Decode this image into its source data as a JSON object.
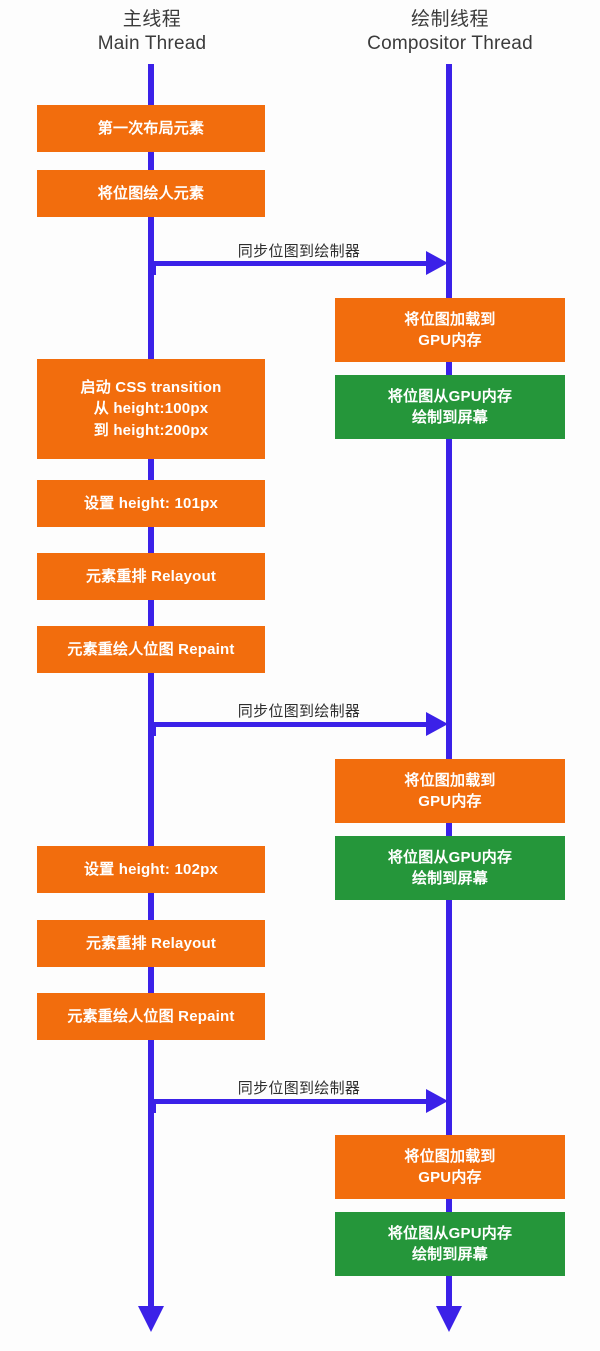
{
  "diagram": {
    "title": "CSS transition main thread vs compositor thread sequence",
    "colors": {
      "orange": "#f26d0d",
      "green": "#25963a",
      "lifeline_blue": "#3b21e8",
      "background": "#fdfdfd",
      "header_text": "#3b3b3b"
    }
  },
  "threads": [
    {
      "zh": "主线程",
      "en": "Main Thread"
    },
    {
      "zh": "绘制线程",
      "en": "Compositor Thread"
    }
  ],
  "main_thread_steps": [
    {
      "text": "第一次布局元素",
      "color": "orange"
    },
    {
      "text": "将位图绘人元素",
      "color": "orange"
    },
    {
      "text": "启动 CSS transition\n从 height:100px\n到 height:200px",
      "color": "orange"
    },
    {
      "text": "设置 height: 101px",
      "color": "orange"
    },
    {
      "text": "元素重排 Relayout",
      "color": "orange"
    },
    {
      "text": "元素重绘人位图 Repaint",
      "color": "orange"
    },
    {
      "text": "设置 height: 102px",
      "color": "orange"
    },
    {
      "text": "元素重排 Relayout",
      "color": "orange"
    },
    {
      "text": "元素重绘人位图 Repaint",
      "color": "orange"
    }
  ],
  "compositor_thread_steps": [
    {
      "text": "将位图加载到\nGPU内存",
      "color": "orange"
    },
    {
      "text": "将位图从GPU内存\n绘制到屏幕",
      "color": "green"
    },
    {
      "text": "将位图加载到\nGPU内存",
      "color": "orange"
    },
    {
      "text": "将位图从GPU内存\n绘制到屏幕",
      "color": "green"
    },
    {
      "text": "将位图加载到\nGPU内存",
      "color": "orange"
    },
    {
      "text": "将位图从GPU内存\n绘制到屏幕",
      "color": "green"
    }
  ],
  "sync_messages": [
    {
      "label": "同步位图到绘制器"
    },
    {
      "label": "同步位图到绘制器"
    },
    {
      "label": "同步位图到绘制器"
    }
  ]
}
